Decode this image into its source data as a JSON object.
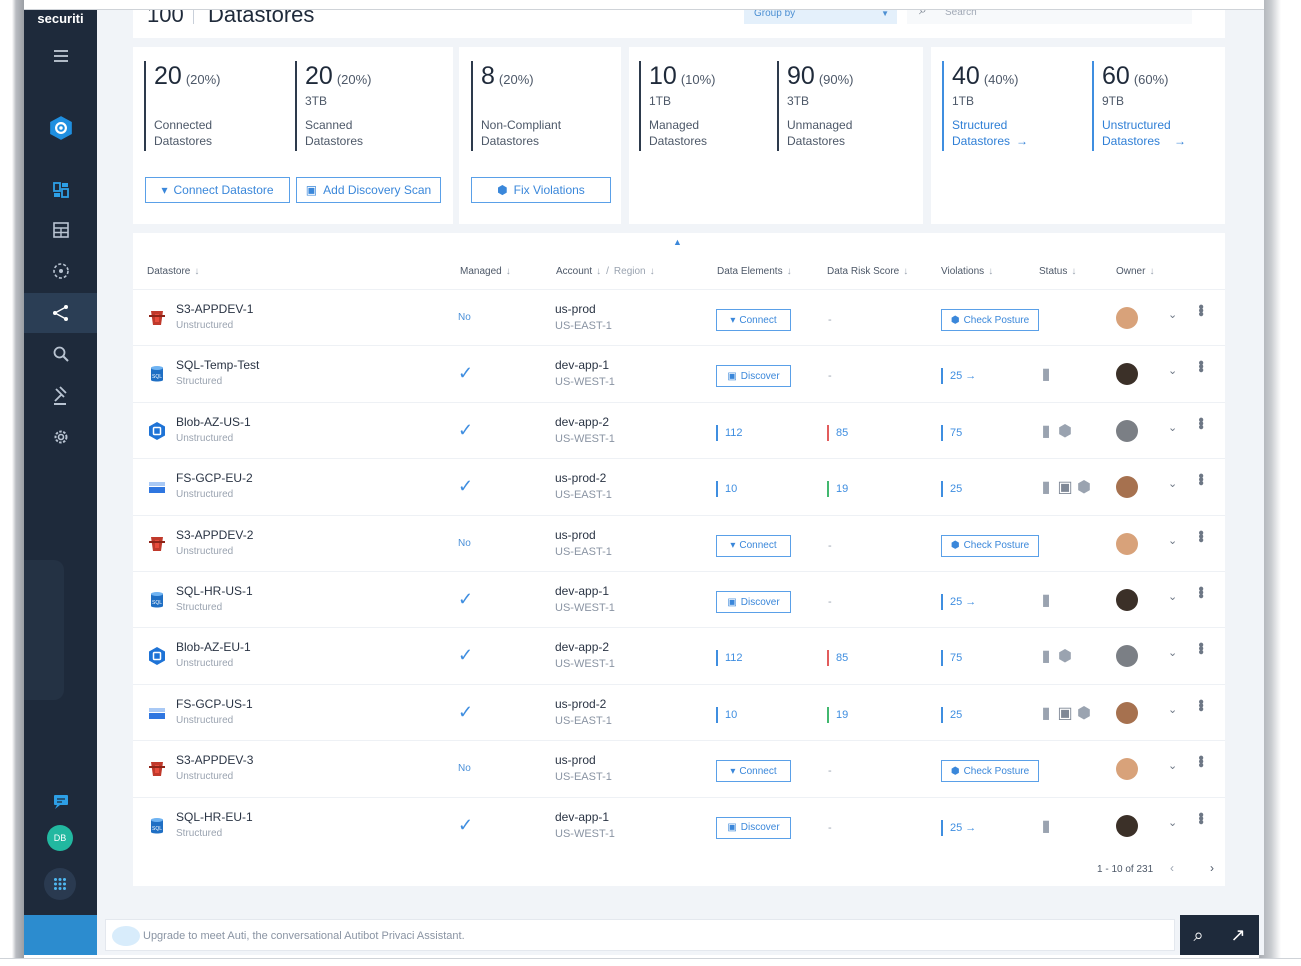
{
  "app": {
    "brand": "securiti",
    "page_count": "100",
    "page_title": "Datastores",
    "group_by": "Group by",
    "search_placeholder": "Search"
  },
  "stats": {
    "connected": {
      "num": "20",
      "pct": "(20%)",
      "size": "",
      "label1": "Connected",
      "label2": "Datastores"
    },
    "scanned": {
      "num": "20",
      "pct": "(20%)",
      "size": "3TB",
      "label1": "Scanned",
      "label2": "Datastores"
    },
    "noncompliant": {
      "num": "8",
      "pct": "(20%)",
      "size": "",
      "label1": "Non-Compliant",
      "label2": "Datastores"
    },
    "managed": {
      "num": "10",
      "pct": "(10%)",
      "size": "1TB",
      "label1": "Managed",
      "label2": "Datastores"
    },
    "unmanaged": {
      "num": "90",
      "pct": "(90%)",
      "size": "3TB",
      "label1": "Unmanaged",
      "label2": "Datastores"
    },
    "structured": {
      "num": "40",
      "pct": "(40%)",
      "size": "1TB",
      "label1": "Structured",
      "label2": "Datastores"
    },
    "unstructured": {
      "num": "60",
      "pct": "(60%)",
      "size": "9TB",
      "label1": "Unstructured",
      "label2": "Datastores"
    }
  },
  "buttons": {
    "connect_datastore": "Connect Datastore",
    "add_discovery_scan": "Add Discovery Scan",
    "fix_violations": "Fix Violations",
    "arrow": "→"
  },
  "table": {
    "headers": {
      "datastore": "Datastore",
      "managed": "Managed",
      "account": "Account",
      "slash": "/",
      "region": "Region",
      "data_elements": "Data Elements",
      "data_risk_score": "Data Risk Score",
      "violations": "Violations",
      "status": "Status",
      "owner": "Owner",
      "sort_arrow": "↓"
    },
    "labels": {
      "connect": "Connect",
      "discover": "Discover",
      "check_posture": "Check Posture",
      "no": "No",
      "check": "✓",
      "dash": "-",
      "arrow": "→"
    },
    "rows": [
      {
        "name": "S3-APPDEV-1",
        "type": "Unstructured",
        "account": "us-prod",
        "region": "US-EAST-1",
        "kind": "s3"
      },
      {
        "name": "SQL-Temp-Test",
        "type": "Structured",
        "account": "dev-app-1",
        "region": "US-WEST-1",
        "kind": "sql",
        "violations": "25"
      },
      {
        "name": "Blob-AZ-US-1",
        "type": "Unstructured",
        "account": "dev-app-2",
        "region": "US-WEST-1",
        "kind": "blob",
        "elements": "112",
        "risk": "85",
        "violations": "75"
      },
      {
        "name": "FS-GCP-EU-2",
        "type": "Unstructured",
        "account": "us-prod-2",
        "region": "US-EAST-1",
        "kind": "gcp",
        "elements": "10",
        "risk": "19",
        "violations": "25"
      },
      {
        "name": "S3-APPDEV-2",
        "type": "Unstructured",
        "account": "us-prod",
        "region": "US-EAST-1",
        "kind": "s3"
      },
      {
        "name": "SQL-HR-US-1",
        "type": "Structured",
        "account": "dev-app-1",
        "region": "US-WEST-1",
        "kind": "sql",
        "violations": "25"
      },
      {
        "name": "Blob-AZ-EU-1",
        "type": "Unstructured",
        "account": "dev-app-2",
        "region": "US-WEST-1",
        "kind": "blob",
        "elements": "112",
        "risk": "85",
        "violations": "75"
      },
      {
        "name": "FS-GCP-US-1",
        "type": "Unstructured",
        "account": "us-prod-2",
        "region": "US-EAST-1",
        "kind": "gcp",
        "elements": "10",
        "risk": "19",
        "violations": "25"
      },
      {
        "name": "S3-APPDEV-3",
        "type": "Unstructured",
        "account": "us-prod",
        "region": "US-EAST-1",
        "kind": "s3"
      },
      {
        "name": "SQL-HR-EU-1",
        "type": "Structured",
        "account": "dev-app-1",
        "region": "US-WEST-1",
        "kind": "sql",
        "violations": "25"
      }
    ],
    "pagination": "1 - 10 of 231",
    "prev": "‹",
    "next": "›"
  },
  "assistant": {
    "text": "Upgrade to meet Auti, the conversational Autibot Privaci Assistant."
  },
  "colors": {
    "sidebar": "#1e2a3b",
    "accent": "#3f8ee0",
    "risk_red": "#e25c5c",
    "risk_green": "#42b86f"
  }
}
